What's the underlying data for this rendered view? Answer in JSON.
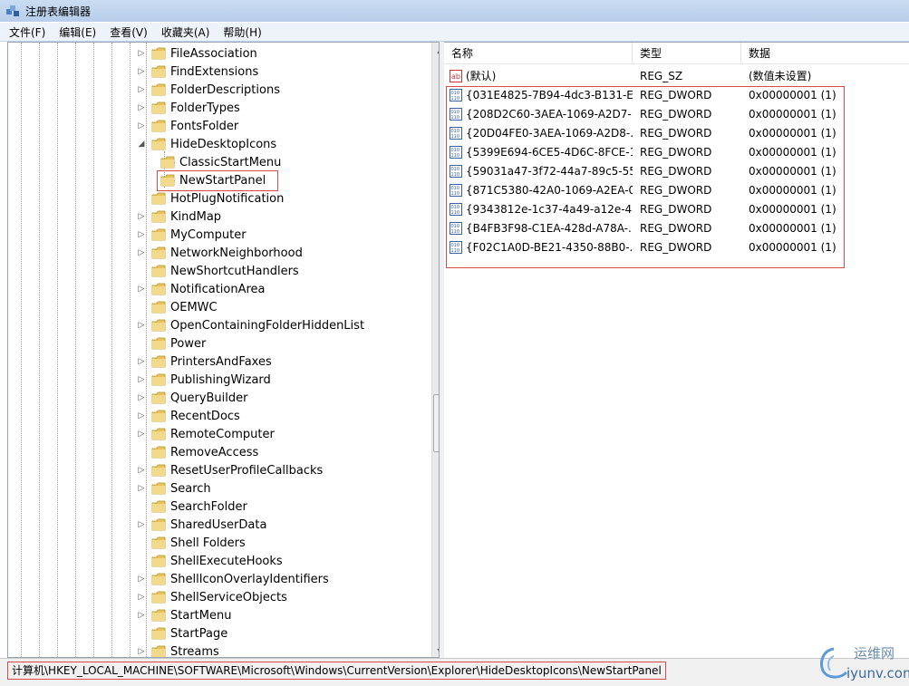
{
  "window": {
    "title": "注册表编辑器"
  },
  "menu": [
    "文件(F)",
    "编辑(E)",
    "查看(V)",
    "收藏夹(A)",
    "帮助(H)"
  ],
  "tree": {
    "items": [
      {
        "label": "FileAssociation",
        "expander": "▷",
        "indent": 0
      },
      {
        "label": "FindExtensions",
        "expander": "▷",
        "indent": 0
      },
      {
        "label": "FolderDescriptions",
        "expander": "▷",
        "indent": 0
      },
      {
        "label": "FolderTypes",
        "expander": "▷",
        "indent": 0
      },
      {
        "label": "FontsFolder",
        "expander": "▷",
        "indent": 0
      },
      {
        "label": "HideDesktopIcons",
        "expander": "◢",
        "indent": 0
      },
      {
        "label": "ClassicStartMenu",
        "expander": "",
        "indent": 1
      },
      {
        "label": "NewStartPanel",
        "expander": "",
        "indent": 1,
        "selected": true
      },
      {
        "label": "HotPlugNotification",
        "expander": "",
        "indent": 0
      },
      {
        "label": "KindMap",
        "expander": "▷",
        "indent": 0
      },
      {
        "label": "MyComputer",
        "expander": "▷",
        "indent": 0
      },
      {
        "label": "NetworkNeighborhood",
        "expander": "▷",
        "indent": 0
      },
      {
        "label": "NewShortcutHandlers",
        "expander": "",
        "indent": 0
      },
      {
        "label": "NotificationArea",
        "expander": "▷",
        "indent": 0
      },
      {
        "label": "OEMWC",
        "expander": "",
        "indent": 0
      },
      {
        "label": "OpenContainingFolderHiddenList",
        "expander": "▷",
        "indent": 0
      },
      {
        "label": "Power",
        "expander": "",
        "indent": 0
      },
      {
        "label": "PrintersAndFaxes",
        "expander": "▷",
        "indent": 0
      },
      {
        "label": "PublishingWizard",
        "expander": "▷",
        "indent": 0
      },
      {
        "label": "QueryBuilder",
        "expander": "▷",
        "indent": 0
      },
      {
        "label": "RecentDocs",
        "expander": "▷",
        "indent": 0
      },
      {
        "label": "RemoteComputer",
        "expander": "▷",
        "indent": 0
      },
      {
        "label": "RemoveAccess",
        "expander": "",
        "indent": 0
      },
      {
        "label": "ResetUserProfileCallbacks",
        "expander": "▷",
        "indent": 0
      },
      {
        "label": "Search",
        "expander": "▷",
        "indent": 0
      },
      {
        "label": "SearchFolder",
        "expander": "",
        "indent": 0
      },
      {
        "label": "SharedUserData",
        "expander": "▷",
        "indent": 0
      },
      {
        "label": "Shell Folders",
        "expander": "",
        "indent": 0
      },
      {
        "label": "ShellExecuteHooks",
        "expander": "",
        "indent": 0
      },
      {
        "label": "ShellIconOverlayIdentifiers",
        "expander": "▷",
        "indent": 0
      },
      {
        "label": "ShellServiceObjects",
        "expander": "▷",
        "indent": 0
      },
      {
        "label": "StartMenu",
        "expander": "▷",
        "indent": 0
      },
      {
        "label": "StartPage",
        "expander": "",
        "indent": 0
      },
      {
        "label": "Streams",
        "expander": "▷",
        "indent": 0
      }
    ]
  },
  "list": {
    "headers": {
      "name": "名称",
      "type": "类型",
      "data": "数据"
    },
    "rows": [
      {
        "icon": "string-value-icon",
        "name": "(默认)",
        "type": "REG_SZ",
        "data": "(数值未设置)"
      },
      {
        "icon": "dword-value-icon",
        "name": "{031E4825-7B94-4dc3-B131-E...",
        "type": "REG_DWORD",
        "data": "0x00000001 (1)"
      },
      {
        "icon": "dword-value-icon",
        "name": "{208D2C60-3AEA-1069-A2D7-...",
        "type": "REG_DWORD",
        "data": "0x00000001 (1)"
      },
      {
        "icon": "dword-value-icon",
        "name": "{20D04FE0-3AEA-1069-A2D8-...",
        "type": "REG_DWORD",
        "data": "0x00000001 (1)"
      },
      {
        "icon": "dword-value-icon",
        "name": "{5399E694-6CE5-4D6C-8FCE-1...",
        "type": "REG_DWORD",
        "data": "0x00000001 (1)"
      },
      {
        "icon": "dword-value-icon",
        "name": "{59031a47-3f72-44a7-89c5-55...",
        "type": "REG_DWORD",
        "data": "0x00000001 (1)"
      },
      {
        "icon": "dword-value-icon",
        "name": "{871C5380-42A0-1069-A2EA-0...",
        "type": "REG_DWORD",
        "data": "0x00000001 (1)"
      },
      {
        "icon": "dword-value-icon",
        "name": "{9343812e-1c37-4a49-a12e-4...",
        "type": "REG_DWORD",
        "data": "0x00000001 (1)"
      },
      {
        "icon": "dword-value-icon",
        "name": "{B4FB3F98-C1EA-428d-A78A-...",
        "type": "REG_DWORD",
        "data": "0x00000001 (1)"
      },
      {
        "icon": "dword-value-icon",
        "name": "{F02C1A0D-BE21-4350-88B0-...",
        "type": "REG_DWORD",
        "data": "0x00000001 (1)"
      }
    ]
  },
  "status": {
    "path": "计算机\\HKEY_LOCAL_MACHINE\\SOFTWARE\\Microsoft\\Windows\\CurrentVersion\\Explorer\\HideDesktopIcons\\NewStartPanel"
  },
  "watermark": {
    "text1": "运维网",
    "text2": "iyunv.com"
  },
  "colors": {
    "highlight": "#d94b4b",
    "folder": "#e8c35a",
    "titlebar": "#c9dcf2"
  }
}
